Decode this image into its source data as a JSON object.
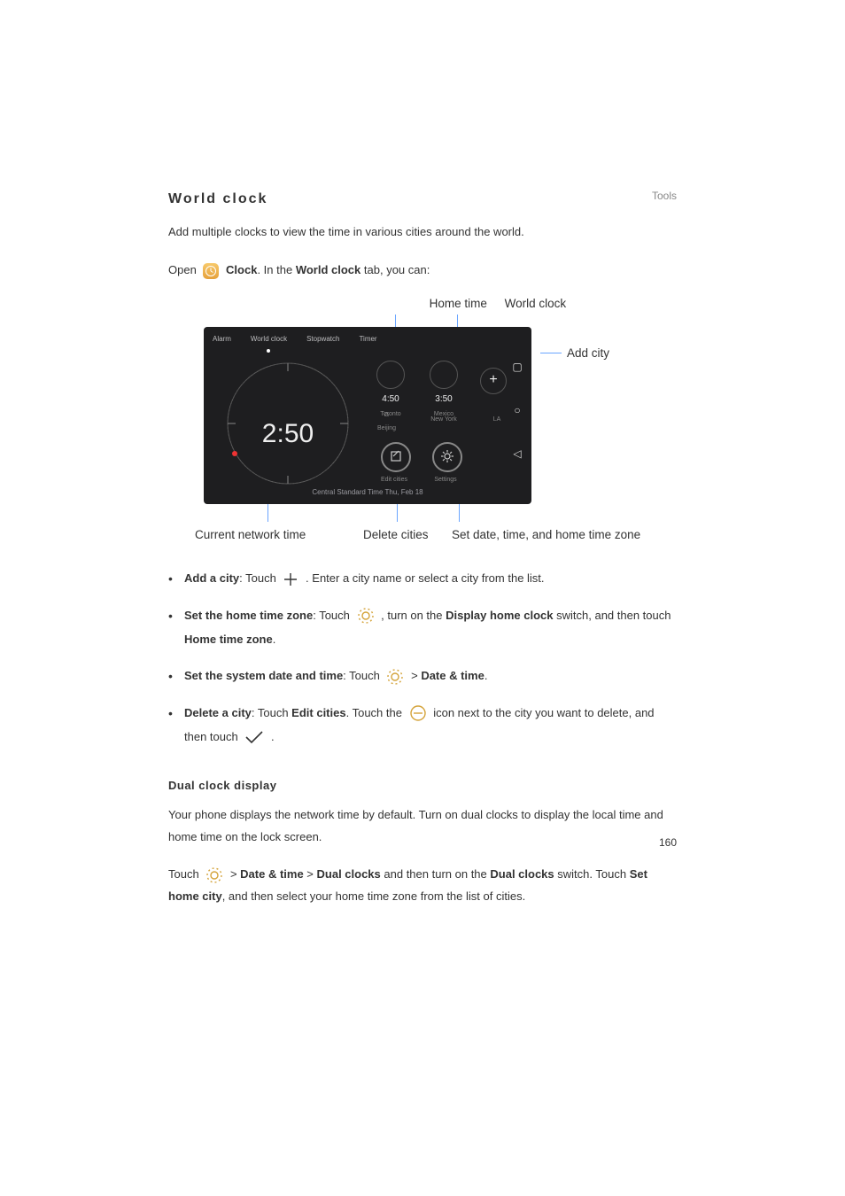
{
  "header": {
    "section_label": "Tools",
    "page_number": "160"
  },
  "sections": {
    "world_clock": {
      "title": "World  clock",
      "intro": "Add multiple clocks to view the time in various cities around the world.",
      "open_pre": "Open ",
      "open_app": "Clock",
      "open_post": ". In the ",
      "open_tab": "World clock",
      "open_tail": " tab, you can:"
    },
    "figure": {
      "top_labels": {
        "home_time": "Home time",
        "world_clock": "World clock"
      },
      "tabs": {
        "alarm": "Alarm",
        "world": "World clock",
        "stop": "Stopwatch",
        "timer": "Timer"
      },
      "big_time": "2:50",
      "big_caption": "Central Standard Time  Thu, Feb 18",
      "mini1": {
        "time": "4:50",
        "city": "Toronto"
      },
      "mini2": {
        "time": "3:50",
        "city": "Mexico"
      },
      "add_plus": "+",
      "home_dial": "Beijing",
      "lab_ny": "New York",
      "lab_la": "LA",
      "under1": "Edit cities",
      "under2": "Settings",
      "nav": {
        "sq": "▢",
        "ci": "○",
        "tr": "◁"
      },
      "right_label": "Add city",
      "bottom_labels": {
        "current": "Current network time",
        "delete": "Delete cities",
        "setdt": "Set date, time, and home time zone"
      }
    },
    "bullets": {
      "b1": {
        "strong": "Add a city",
        "pre": ": Touch ",
        "post": " . Enter a city name or select a city from the list."
      },
      "b2": {
        "strong": "Set the home time zone",
        "pre": ": Touch ",
        "mid1": " , turn on the ",
        "sw": "Display home clock",
        "mid2": " switch, and then touch ",
        "htz": "Home time zone",
        "tail": "."
      },
      "b3": {
        "strong": "Set the system date and time",
        "pre": ": Touch ",
        "gt": "  > ",
        "dt": "Date & time",
        "tail": "."
      },
      "b4": {
        "strong": "Delete a city",
        "pre": ": Touch ",
        "ec": "Edit cities",
        "mid": ". Touch the ",
        "post": " icon next to the city you want to delete, and then touch ",
        "tail": " ."
      }
    },
    "dual": {
      "heading": "Dual clock display",
      "para1": "Your phone displays the network time by default. Turn on dual clocks to display the local time and home time on the lock screen.",
      "p2_pre": "Touch ",
      "p2_gt1": "  > ",
      "p2_dt": "Date & time",
      "p2_gt2": " > ",
      "p2_dc": "Dual clocks",
      "p2_mid": " and then turn on the ",
      "p2_dc2": "Dual clocks",
      "p2_mid2": " switch. Touch ",
      "p2_shc": "Set home city",
      "p2_tail": ", and then select your home time zone from the list of cities."
    }
  }
}
